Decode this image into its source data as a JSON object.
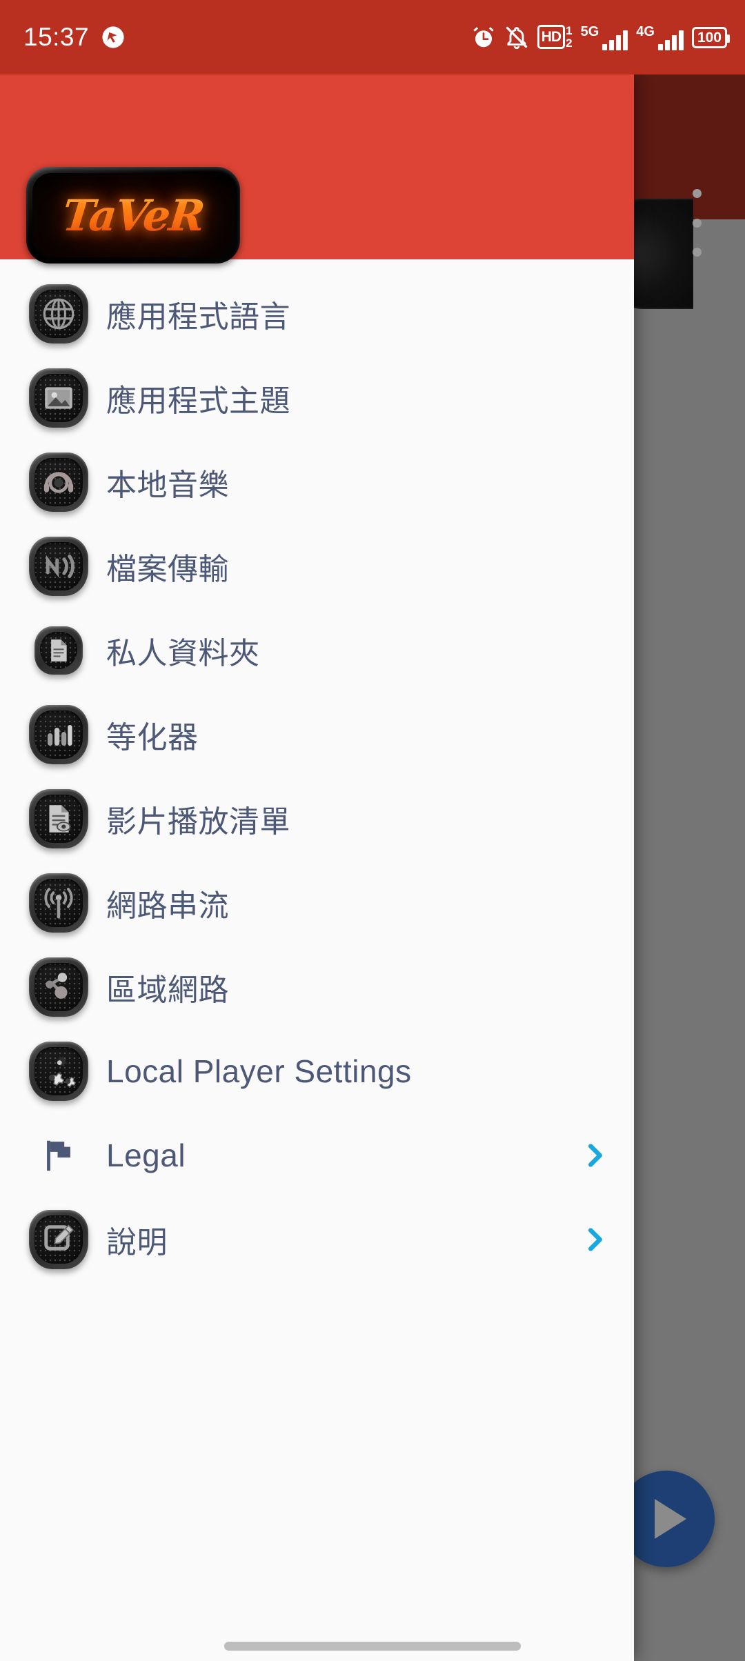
{
  "status_bar": {
    "time": "15:37",
    "icons": {
      "notification_dot": "silenced-notification-icon",
      "alarm": "alarm-clock-icon",
      "ringer": "bell-muted-icon",
      "hd_label": "HD",
      "hd_sup": "1",
      "hd_sub": "2",
      "sim1_network": "5G",
      "sim2_network": "4G",
      "battery_level": "100"
    },
    "background_color": "#b93021"
  },
  "background_app": {
    "appbar_color": "#5c1a12",
    "overflow_menu": "overflow-menu-icon",
    "fab": "play-fab",
    "scrim_color": "#757575"
  },
  "drawer": {
    "header": {
      "background_color": "#dd4436",
      "logo_text": "TaVeR"
    },
    "text_color": "#4c5876",
    "chevron_color": "#17a8e0",
    "items": [
      {
        "label": "應用程式語言",
        "icon": "globe-icon",
        "style": "squircle",
        "chevron": false,
        "latin": false
      },
      {
        "label": "應用程式主題",
        "icon": "image-icon",
        "style": "squircle",
        "chevron": false,
        "latin": false
      },
      {
        "label": "本地音樂",
        "icon": "headphones-icon",
        "style": "squircle",
        "chevron": false,
        "latin": false
      },
      {
        "label": "檔案傳輸",
        "icon": "nfc-transfer-icon",
        "style": "squircle",
        "chevron": false,
        "latin": false
      },
      {
        "label": "私人資料夾",
        "icon": "document-icon",
        "style": "squircle-small",
        "chevron": false,
        "latin": false
      },
      {
        "label": "等化器",
        "icon": "equalizer-icon",
        "style": "squircle",
        "chevron": false,
        "latin": false
      },
      {
        "label": "影片播放清單",
        "icon": "playlist-document-icon",
        "style": "squircle",
        "chevron": false,
        "latin": false
      },
      {
        "label": "網路串流",
        "icon": "broadcast-icon",
        "style": "squircle",
        "chevron": false,
        "latin": false
      },
      {
        "label": "區域網路",
        "icon": "network-nodes-icon",
        "style": "squircle",
        "chevron": false,
        "latin": false
      },
      {
        "label": "Local Player Settings",
        "icon": "gears-icon",
        "style": "squircle",
        "chevron": false,
        "latin": true
      },
      {
        "label": "Legal",
        "icon": "flag-icon",
        "style": "plain",
        "chevron": true,
        "latin": true
      },
      {
        "label": "說明",
        "icon": "edit-note-icon",
        "style": "squircle",
        "chevron": true,
        "latin": false
      }
    ]
  },
  "nav_bar": {
    "handle": "gesture-home-pill"
  }
}
